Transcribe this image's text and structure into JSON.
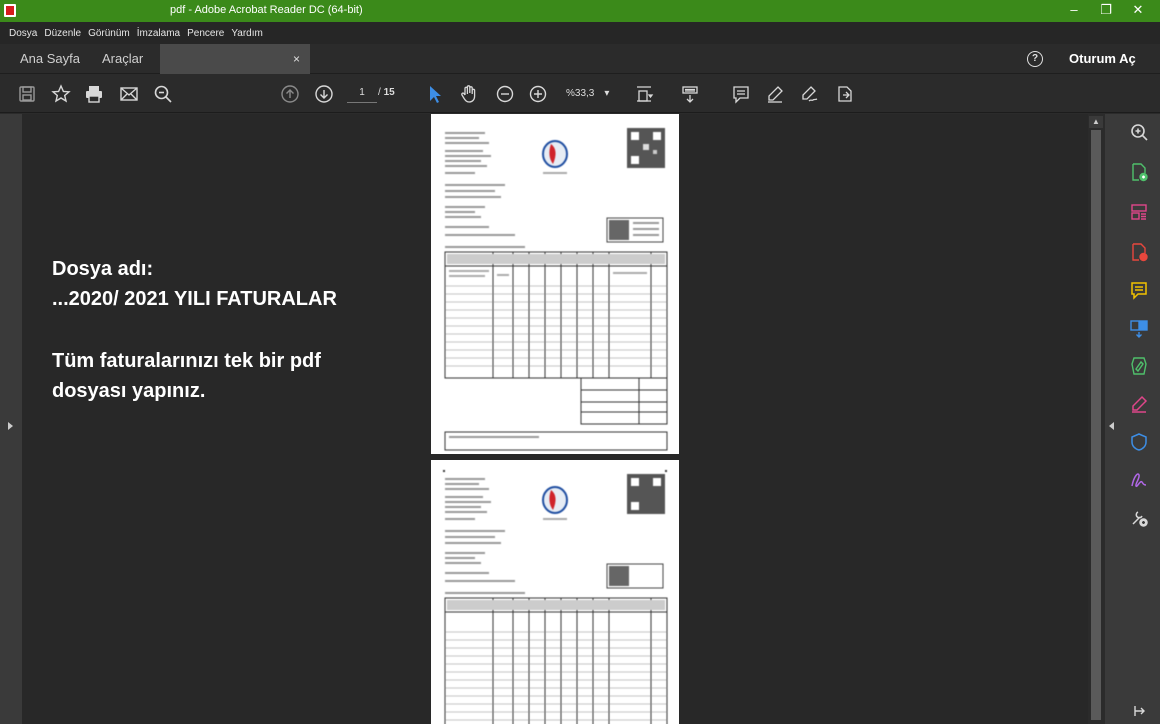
{
  "window": {
    "title": "pdf - Adobe Acrobat Reader DC (64-bit)",
    "controls": [
      "minimize-icon",
      "restore-icon",
      "close-icon"
    ]
  },
  "menu": {
    "items": [
      "Dosya",
      "Düzenle",
      "Görünüm",
      "İmzalama",
      "Pencere",
      "Yardım"
    ]
  },
  "tabs": {
    "home": "Ana Sayfa",
    "tools": "Araçlar",
    "close": "×",
    "help": "?",
    "signin": "Oturum Aç"
  },
  "toolbar": {
    "page_current": "1",
    "page_separator": "/",
    "page_total": "15",
    "zoom": "%33,3",
    "icons": [
      "save-icon",
      "bookmark-star-icon",
      "print-icon",
      "email-icon",
      "search-zoom-icon",
      "page-up-icon",
      "page-down-icon",
      "select-cursor-icon",
      "hand-icon",
      "zoom-out-icon",
      "zoom-in-icon",
      "fit-page-icon",
      "scroll-mode-icon",
      "comment-icon",
      "highlight-pen-icon",
      "sign-icon",
      "share-icon"
    ]
  },
  "overlay": {
    "line1": "Dosya adı:",
    "line2": "...2020/ 2021 YILI FATURALAR",
    "line3": "Tüm faturalarınızı tek bir pdf",
    "line4": "dosyası yapınız."
  },
  "right_panel": {
    "icons": [
      "zoom-search-icon",
      "create-pdf-icon",
      "organize-pages-icon",
      "export-pdf-icon",
      "comment-icon",
      "combine-files-icon",
      "edit-pdf-icon",
      "fill-sign-icon",
      "protect-icon",
      "signature-icon",
      "more-tools-icon",
      "expand-icon"
    ]
  },
  "colors": {
    "titlebar": "#3b8a1a",
    "accent_blue": "#3d8ee6",
    "background": "#282828"
  }
}
